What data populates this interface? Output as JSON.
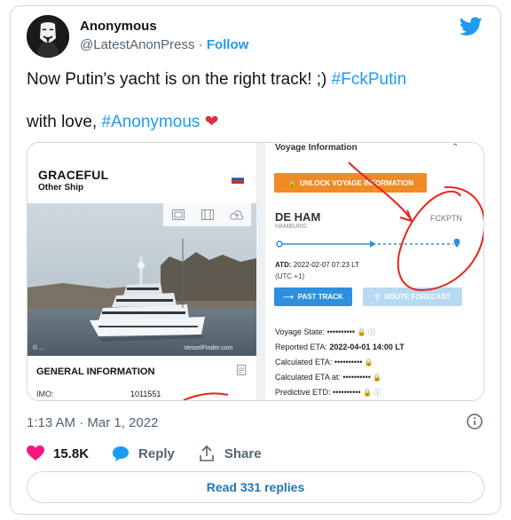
{
  "tweet": {
    "author_name": "Anonymous",
    "author_handle": "@LatestAnonPress",
    "separator": " · ",
    "follow_label": "Follow",
    "text_line1": "Now Putin's yacht is on the right track! ;) ",
    "hashtag1": "#FckPutin",
    "text_line2": "with love, ",
    "hashtag2": "#Anonymous",
    "heart": "❤",
    "timestamp": "1:13 AM · Mar 1, 2022",
    "likes_count": "15.8K",
    "reply_label": "Reply",
    "share_label": "Share",
    "read_replies_label": "Read 331 replies",
    "accent_color": "#1d9bf0"
  },
  "media": {
    "ship_name": "GRACEFUL",
    "ship_type": "Other Ship",
    "photo_credit_left": "© ...",
    "photo_credit_right": "VesselFinder.com",
    "general_info_title": "GENERAL INFORMATION",
    "imo_label": "IMO:",
    "imo_value": "1011551",
    "voyage_title": "Voyage Information",
    "unlock_label": "UNLOCK VOYAGE INFORMATION",
    "departure_port": "DE HAM",
    "departure_port_name": "HAMBURG",
    "destination_port": "FCKPTN",
    "atd_label": "ATD:",
    "atd_value": " 2022-02-07 07:23 LT",
    "utc_offset": "(UTC +1)",
    "past_track_label": "PAST TRACK",
    "route_forecast_label": "ROUTE FORECAST",
    "voyage_state_label": "Voyage State: ",
    "reported_eta_label": "Reported ETA: ",
    "reported_eta_value": "2022-04-01 14:00 LT",
    "calculated_eta_label": "Calculated ETA: ",
    "calculated_eta_at_label": "Calculated ETA at: ",
    "predictive_etd_label": "Predictive ETD: ",
    "hidden_value": "••••••••••",
    "orange": "#f08a24",
    "blue": "#2d8fe0",
    "annotation_red": "#e8241c"
  }
}
